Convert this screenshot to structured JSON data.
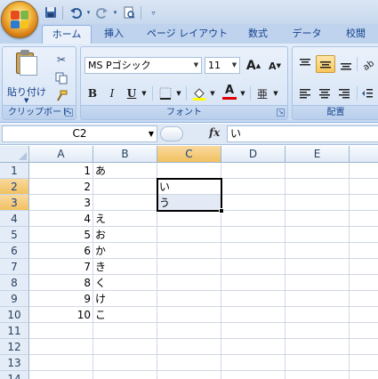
{
  "quick_access": {
    "icons": [
      "save-icon",
      "undo-icon",
      "redo-icon",
      "print-preview-icon",
      "customize-arrow-icon"
    ]
  },
  "tabs": [
    {
      "label": "ホーム",
      "active": true
    },
    {
      "label": "挿入"
    },
    {
      "label": "ページ レイアウト"
    },
    {
      "label": "数式"
    },
    {
      "label": "データ"
    },
    {
      "label": "校閲"
    }
  ],
  "ribbon": {
    "clipboard": {
      "paste_label": "貼り付け",
      "group_label": "クリップボード"
    },
    "font": {
      "font_name": "MS Pゴシック",
      "font_size": "11",
      "group_label": "フォント",
      "bold": "B",
      "italic": "I",
      "underline": "U",
      "grow": "A",
      "shrink": "A",
      "font_color_letter": "A",
      "phonetic": "亜"
    },
    "alignment": {
      "group_label": "配置"
    }
  },
  "formula_bar": {
    "name_box": "C2",
    "fx_label": "fx",
    "content": "い"
  },
  "columns": [
    "A",
    "B",
    "C",
    "D",
    "E"
  ],
  "selected_column": "C",
  "rows": [
    {
      "num": "1",
      "a": "1",
      "b": "あ",
      "c": ""
    },
    {
      "num": "2",
      "a": "2",
      "b": "",
      "c": "い"
    },
    {
      "num": "3",
      "a": "3",
      "b": "",
      "c": "う"
    },
    {
      "num": "4",
      "a": "4",
      "b": "え",
      "c": ""
    },
    {
      "num": "5",
      "a": "5",
      "b": "お",
      "c": ""
    },
    {
      "num": "6",
      "a": "6",
      "b": "か",
      "c": ""
    },
    {
      "num": "7",
      "a": "7",
      "b": "き",
      "c": ""
    },
    {
      "num": "8",
      "a": "8",
      "b": "く",
      "c": ""
    },
    {
      "num": "9",
      "a": "9",
      "b": "け",
      "c": ""
    },
    {
      "num": "10",
      "a": "10",
      "b": "こ",
      "c": ""
    },
    {
      "num": "11",
      "a": "",
      "b": "",
      "c": ""
    },
    {
      "num": "12",
      "a": "",
      "b": "",
      "c": ""
    },
    {
      "num": "13",
      "a": "",
      "b": "",
      "c": ""
    },
    {
      "num": "14",
      "a": "",
      "b": "",
      "c": ""
    }
  ],
  "selected_rows": [
    "2",
    "3"
  ],
  "colors": {
    "accent": "#15428b",
    "header_selected": "#f1c15f",
    "grid_line": "#d0d7e5"
  }
}
